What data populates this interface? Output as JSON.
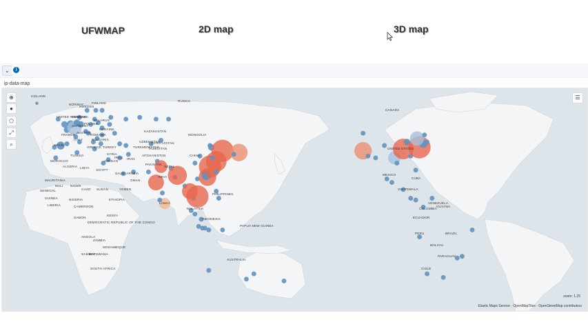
{
  "nav": {
    "ufwmap": "UFWMAP",
    "map2d": "2D map",
    "map3d": "3D map"
  },
  "panel": {
    "title": "ip-data-map"
  },
  "map": {
    "zoom_text": "zoom: 1.25",
    "attribution": {
      "service": "Elastic Maps Service",
      "tiles": "OpenMapTiles",
      "osm": "OpenStreetMap contributors"
    },
    "labels": {
      "iceland": "Iceland",
      "norway": "Norway",
      "sweden": "Sweden",
      "finland": "Finland",
      "russia": "Russia",
      "united_kingdom": "United Kingdom",
      "denmark": "Denmark",
      "poland": "Poland",
      "belarus": "Belarus",
      "ukraine": "Ukraine",
      "germany": "Germany",
      "france": "France",
      "austria": "Austria",
      "romania": "Romania",
      "italy": "Italy",
      "bulgaria": "Bulgaria",
      "spain": "Spain",
      "greece": "Greece",
      "turkey": "Turkey",
      "syria": "Syria",
      "iraq": "Iraq",
      "iran": "Iran",
      "tunisia": "Tunisia",
      "morocco": "Morocco",
      "algeria": "Algeria",
      "libya": "Libya",
      "egypt": "Egypt",
      "jordan": "Jordan",
      "saudi_arabia": "Saudi Arabia",
      "yemen": "Yemen",
      "oman": "Oman",
      "afghanistan": "Afghanistan",
      "pakistan": "Pakistan",
      "kazakhstan": "Kazakhstan",
      "uzbekistan": "Uzbekistan",
      "turkmenistan": "Turkmenistan",
      "kyrgyzstan": "Kyrgyzstan",
      "tajikistan": "Tajikistan",
      "mongolia": "Mongolia",
      "china": "China",
      "india": "India",
      "nepal": "Nepal",
      "lanka": "Lanka",
      "philippines": "Philippines",
      "malaysia": "Malaysia",
      "indonesia": "Indonesia",
      "papua_new_guinea": "Papua New Guinea",
      "australia": "Australia",
      "mauritania": "Mauritania",
      "mali": "Mali",
      "niger": "Niger",
      "chad": "Chad",
      "sudan": "Sudan",
      "ethiopia": "Ethiopia",
      "senegal": "Senegal",
      "guinea": "Guinea",
      "liberia": "Liberia",
      "nigeria": "Nigeria",
      "cameroon": "Cameroon",
      "gabon": "Gabon",
      "democratic_republic_of_the_congo": "Democratic Republic of the Congo",
      "kenya": "Kenya",
      "angola": "Angola",
      "zambia": "Zambia",
      "mozambique": "Mozambique",
      "namibia": "Namibia",
      "botswana": "Botswana",
      "south_africa": "South Africa",
      "canada": "Canada",
      "united_states": "United States",
      "mexico": "Mexico",
      "cuba": "Cuba",
      "guatemala": "Guatemala",
      "colombia": "Colombia",
      "venezuela": "Venezuela",
      "guyana": "Guyana",
      "ecuador": "Ecuador",
      "peru": "Peru",
      "brazil": "Brazil",
      "bolivia": "Bolivia",
      "paraguay": "Paraguay",
      "chile": "Chile"
    }
  },
  "points": [
    {
      "lon": -22,
      "lat": 64,
      "size": 2,
      "color": "#6092c0"
    },
    {
      "lon": -5,
      "lat": 55,
      "size": 3,
      "color": "#6092c0"
    },
    {
      "lon": 0,
      "lat": 52,
      "size": 4,
      "color": "#6092c0"
    },
    {
      "lon": 2,
      "lat": 49,
      "size": 4,
      "color": "#6092c0"
    },
    {
      "lon": 5,
      "lat": 52,
      "size": 5,
      "color": "#6092c0"
    },
    {
      "lon": 8,
      "lat": 50,
      "size": 9,
      "color": "#a6c1de"
    },
    {
      "lon": 10,
      "lat": 53,
      "size": 4,
      "color": "#6092c0"
    },
    {
      "lon": 13,
      "lat": 52,
      "size": 4,
      "color": "#6092c0"
    },
    {
      "lon": 12,
      "lat": 56,
      "size": 3,
      "color": "#6092c0"
    },
    {
      "lon": 18,
      "lat": 60,
      "size": 3,
      "color": "#6092c0"
    },
    {
      "lon": 25,
      "lat": 60,
      "size": 3,
      "color": "#6092c0"
    },
    {
      "lon": 24,
      "lat": 55,
      "size": 3,
      "color": "#6092c0"
    },
    {
      "lon": 21,
      "lat": 52,
      "size": 3,
      "color": "#6092c0"
    },
    {
      "lon": 27,
      "lat": 53,
      "size": 3,
      "color": "#6092c0"
    },
    {
      "lon": 30,
      "lat": 50,
      "size": 3,
      "color": "#6092c0"
    },
    {
      "lon": 37,
      "lat": 56,
      "size": 3,
      "color": "#6092c0"
    },
    {
      "lon": 30,
      "lat": 60,
      "size": 3,
      "color": "#6092c0"
    },
    {
      "lon": 17,
      "lat": 48,
      "size": 3,
      "color": "#6092c0"
    },
    {
      "lon": 19,
      "lat": 47,
      "size": 3,
      "color": "#6092c0"
    },
    {
      "lon": 26,
      "lat": 44,
      "size": 3,
      "color": "#6092c0"
    },
    {
      "lon": 23,
      "lat": 42,
      "size": 3,
      "color": "#6092c0"
    },
    {
      "lon": 12,
      "lat": 42,
      "size": 3,
      "color": "#6092c0"
    },
    {
      "lon": 9,
      "lat": 45,
      "size": 3,
      "color": "#6092c0"
    },
    {
      "lon": -3,
      "lat": 40,
      "size": 5,
      "color": "#6092c0"
    },
    {
      "lon": -8,
      "lat": 39,
      "size": 3,
      "color": "#6092c0"
    },
    {
      "lon": 2,
      "lat": 41,
      "size": 3,
      "color": "#6092c0"
    },
    {
      "lon": 29,
      "lat": 41,
      "size": 3,
      "color": "#6092c0"
    },
    {
      "lon": 24,
      "lat": 38,
      "size": 3,
      "color": "#6092c0"
    },
    {
      "lon": 35,
      "lat": 32,
      "size": 3,
      "color": "#6092c0"
    },
    {
      "lon": 31,
      "lat": 30,
      "size": 3,
      "color": "#6092c0"
    },
    {
      "lon": 44,
      "lat": 33,
      "size": 3,
      "color": "#6092c0"
    },
    {
      "lon": 51,
      "lat": 35,
      "size": 3,
      "color": "#6092c0"
    },
    {
      "lon": 55,
      "lat": 25,
      "size": 3,
      "color": "#6092c0"
    },
    {
      "lon": 47,
      "lat": 24,
      "size": 3,
      "color": "#6092c0"
    },
    {
      "lon": 10,
      "lat": 36,
      "size": 3,
      "color": "#6092c0"
    },
    {
      "lon": -7,
      "lat": 33,
      "size": 3,
      "color": "#6092c0"
    },
    {
      "lon": 30,
      "lat": 46,
      "size": 3,
      "color": "#6092c0"
    },
    {
      "lon": 40,
      "lat": 47,
      "size": 3,
      "color": "#6092c0"
    },
    {
      "lon": 44,
      "lat": 41,
      "size": 3,
      "color": "#6092c0"
    },
    {
      "lon": 49,
      "lat": 40,
      "size": 3,
      "color": "#6092c0"
    },
    {
      "lon": 36,
      "lat": 52,
      "size": 3,
      "color": "#6092c0"
    },
    {
      "lon": 60,
      "lat": 56,
      "size": 3,
      "color": "#6092c0"
    },
    {
      "lon": 49,
      "lat": 55,
      "size": 3,
      "color": "#6092c0"
    },
    {
      "lon": 73,
      "lat": 55,
      "size": 3,
      "color": "#6092c0"
    },
    {
      "lon": 83,
      "lat": 55,
      "size": 3,
      "color": "#6092c0"
    },
    {
      "lon": 69,
      "lat": 41,
      "size": 3,
      "color": "#6092c0"
    },
    {
      "lon": 77,
      "lat": 43,
      "size": 3,
      "color": "#6092c0"
    },
    {
      "lon": 67,
      "lat": 25,
      "size": 3,
      "color": "#6092c0"
    },
    {
      "lon": 74,
      "lat": 31,
      "size": 3,
      "color": "#6092c0"
    },
    {
      "lon": 77,
      "lat": 28,
      "size": 8,
      "color": "#e7664c"
    },
    {
      "lon": 73,
      "lat": 19,
      "size": 10,
      "color": "#e7664c"
    },
    {
      "lon": 78,
      "lat": 13,
      "size": 3,
      "color": "#6092c0"
    },
    {
      "lon": 80,
      "lat": 7,
      "size": 7,
      "color": "#f1b98e"
    },
    {
      "lon": 76,
      "lat": 9,
      "size": 3,
      "color": "#6092c0"
    },
    {
      "lon": 85,
      "lat": 27,
      "size": 3,
      "color": "#6092c0"
    },
    {
      "lon": 88,
      "lat": 22,
      "size": 3,
      "color": "#6092c0"
    },
    {
      "lon": 90,
      "lat": 23,
      "size": 12,
      "color": "#e7664c"
    },
    {
      "lon": 96,
      "lat": 17,
      "size": 3,
      "color": "#6092c0"
    },
    {
      "lon": 100,
      "lat": 14,
      "size": 10,
      "color": "#e7664c"
    },
    {
      "lon": 103,
      "lat": 10,
      "size": 3,
      "color": "#6092c0"
    },
    {
      "lon": 106,
      "lat": 11,
      "size": 14,
      "color": "#e7664c"
    },
    {
      "lon": 101,
      "lat": 3,
      "size": 3,
      "color": "#6092c0"
    },
    {
      "lon": 104,
      "lat": 1,
      "size": 3,
      "color": "#6092c0"
    },
    {
      "lon": 107,
      "lat": -6,
      "size": 3,
      "color": "#6092c0"
    },
    {
      "lon": 112,
      "lat": -7,
      "size": 3,
      "color": "#6092c0"
    },
    {
      "lon": 115,
      "lat": -8,
      "size": 3,
      "color": "#6092c0"
    },
    {
      "lon": 110,
      "lat": -7,
      "size": 3,
      "color": "#6092c0"
    },
    {
      "lon": 106,
      "lat": 21,
      "size": 3,
      "color": "#6092c0"
    },
    {
      "lon": 114,
      "lat": 22,
      "size": 11,
      "color": "#e7664c"
    },
    {
      "lon": 113,
      "lat": 23,
      "size": 6,
      "color": "#6092c0"
    },
    {
      "lon": 116,
      "lat": 28,
      "size": 14,
      "color": "#e7664c"
    },
    {
      "lon": 121,
      "lat": 31,
      "size": 13,
      "color": "#e7664c"
    },
    {
      "lon": 117,
      "lat": 39,
      "size": 4,
      "color": "#6092c0"
    },
    {
      "lon": 116,
      "lat": 40,
      "size": 3,
      "color": "#6092c0"
    },
    {
      "lon": 126,
      "lat": 37,
      "size": 14,
      "color": "#e7664c"
    },
    {
      "lon": 121,
      "lat": 25,
      "size": 3,
      "color": "#6092c0"
    },
    {
      "lon": 121,
      "lat": 14,
      "size": 3,
      "color": "#6092c0"
    },
    {
      "lon": 123,
      "lat": 10,
      "size": 3,
      "color": "#6092c0"
    },
    {
      "lon": 139,
      "lat": 36,
      "size": 11,
      "color": "#eb8f70"
    },
    {
      "lon": 135,
      "lat": 35,
      "size": 3,
      "color": "#6092c0"
    },
    {
      "lon": 118,
      "lat": 33,
      "size": 3,
      "color": "#6092c0"
    },
    {
      "lon": 104,
      "lat": 30,
      "size": 3,
      "color": "#6092c0"
    },
    {
      "lon": 108,
      "lat": 34,
      "size": 3,
      "color": "#6092c0"
    },
    {
      "lon": 112,
      "lat": 23,
      "size": 3,
      "color": "#6092c0"
    },
    {
      "lon": 109,
      "lat": -2,
      "size": 3,
      "color": "#6092c0"
    },
    {
      "lon": 126,
      "lat": -8,
      "size": 3,
      "color": "#6092c0"
    },
    {
      "lon": 145,
      "lat": -36,
      "size": 3,
      "color": "#6092c0"
    },
    {
      "lon": 151,
      "lat": -33,
      "size": 3,
      "color": "#6092c0"
    },
    {
      "lon": 115,
      "lat": -31,
      "size": 3,
      "color": "#6092c0"
    },
    {
      "lon": 175,
      "lat": -37,
      "size": 3,
      "color": "#6092c0"
    },
    {
      "lon": -122,
      "lat": 37,
      "size": 11,
      "color": "#eb8f70"
    },
    {
      "lon": -122,
      "lat": 47,
      "size": 3,
      "color": "#6092c0"
    },
    {
      "lon": -118,
      "lat": 34,
      "size": 3,
      "color": "#6092c0"
    },
    {
      "lon": -112,
      "lat": 33,
      "size": 3,
      "color": "#6092c0"
    },
    {
      "lon": -105,
      "lat": 40,
      "size": 3,
      "color": "#6092c0"
    },
    {
      "lon": -97,
      "lat": 33,
      "size": 8,
      "color": "#a6c1de"
    },
    {
      "lon": -95,
      "lat": 30,
      "size": 3,
      "color": "#6092c0"
    },
    {
      "lon": -90,
      "lat": 38,
      "size": 13,
      "color": "#e7664c"
    },
    {
      "lon": -87,
      "lat": 42,
      "size": 4,
      "color": "#6092c0"
    },
    {
      "lon": -84,
      "lat": 34,
      "size": 3,
      "color": "#6092c0"
    },
    {
      "lon": -80,
      "lat": 26,
      "size": 3,
      "color": "#6092c0"
    },
    {
      "lon": -77,
      "lat": 39,
      "size": 14,
      "color": "#e7664c"
    },
    {
      "lon": -74,
      "lat": 41,
      "size": 5,
      "color": "#6092c0"
    },
    {
      "lon": -71,
      "lat": 42,
      "size": 3,
      "color": "#6092c0"
    },
    {
      "lon": -79,
      "lat": 44,
      "size": 9,
      "color": "#a6c1de"
    },
    {
      "lon": -73,
      "lat": 46,
      "size": 3,
      "color": "#6092c0"
    },
    {
      "lon": -99,
      "lat": 19,
      "size": 3,
      "color": "#6092c0"
    },
    {
      "lon": -103,
      "lat": 21,
      "size": 3,
      "color": "#6092c0"
    },
    {
      "lon": -90,
      "lat": 15,
      "size": 3,
      "color": "#6092c0"
    },
    {
      "lon": -84,
      "lat": 10,
      "size": 3,
      "color": "#6092c0"
    },
    {
      "lon": -80,
      "lat": 9,
      "size": 3,
      "color": "#6092c0"
    },
    {
      "lon": -74,
      "lat": 5,
      "size": 3,
      "color": "#6092c0"
    },
    {
      "lon": -67,
      "lat": 10,
      "size": 3,
      "color": "#6092c0"
    },
    {
      "lon": -43,
      "lat": -23,
      "size": 3,
      "color": "#6092c0"
    },
    {
      "lon": -47,
      "lat": -24,
      "size": 3,
      "color": "#6092c0"
    },
    {
      "lon": -58,
      "lat": -35,
      "size": 3,
      "color": "#6092c0"
    },
    {
      "lon": -71,
      "lat": -33,
      "size": 3,
      "color": "#6092c0"
    },
    {
      "lon": -77,
      "lat": -12,
      "size": 3,
      "color": "#6092c0"
    },
    {
      "lon": -35,
      "lat": -8,
      "size": 3,
      "color": "#6092c0"
    }
  ]
}
